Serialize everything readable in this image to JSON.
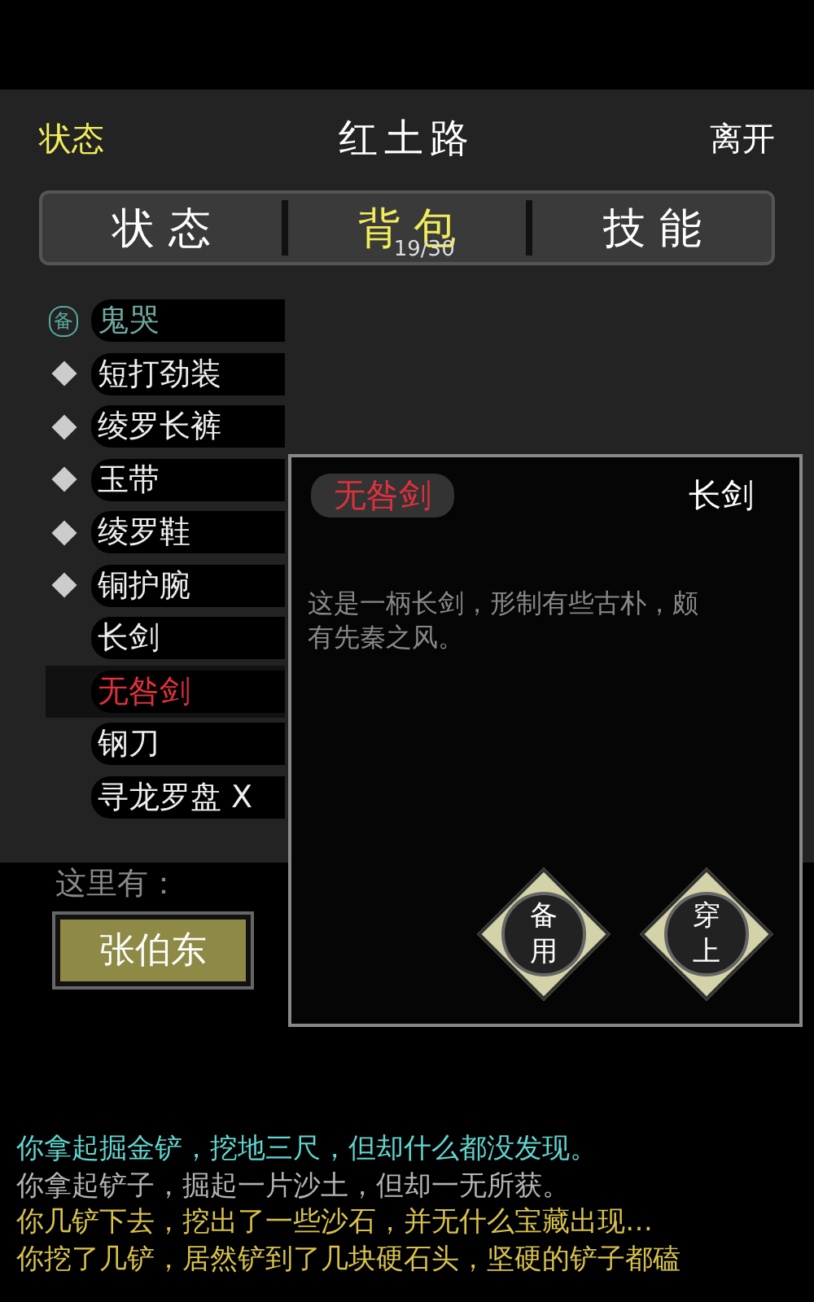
{
  "header": {
    "left": "状态",
    "title": "红土路",
    "right": "离开"
  },
  "tabs": [
    {
      "label": "状 态",
      "selected": false
    },
    {
      "label": "背 包",
      "selected": true,
      "count": "19/30"
    },
    {
      "label": "技 能",
      "selected": false
    }
  ],
  "items": [
    {
      "kind": "reserve",
      "badge": "备",
      "name": "鬼哭",
      "selected": false
    },
    {
      "kind": "equipped",
      "name": "短打劲装",
      "selected": false
    },
    {
      "kind": "equipped",
      "name": "绫罗长裤",
      "selected": false
    },
    {
      "kind": "equipped",
      "name": "玉带",
      "selected": false
    },
    {
      "kind": "equipped",
      "name": "绫罗鞋",
      "selected": false
    },
    {
      "kind": "equipped",
      "name": "铜护腕",
      "selected": false
    },
    {
      "kind": "plain",
      "name": "长剑",
      "selected": false
    },
    {
      "kind": "plain",
      "name": "无咎剑",
      "selected": true
    },
    {
      "kind": "plain",
      "name": "钢刀",
      "selected": false
    },
    {
      "kind": "plain",
      "name": "寻龙罗盘 X",
      "selected": false
    }
  ],
  "detail": {
    "name": "无咎剑",
    "type": "长剑",
    "description": "这是一柄长剑，形制有些古朴，颇有先秦之风。",
    "buttons": [
      "备用",
      "穿上"
    ]
  },
  "here": {
    "label": "这里有：",
    "npcs": [
      "张伯东"
    ]
  },
  "log": [
    {
      "text": "你拿起掘金铲，挖地三尺，但却什么都没发现。",
      "color": "#5fd6d0"
    },
    {
      "text": "你拿起铲子，掘起一片沙土，但却一无所获。",
      "color": "#b4b4b4"
    },
    {
      "text": "你几铲下去，挖出了一些沙石，并无什么宝藏出现…",
      "color": "#d8c24a"
    },
    {
      "text": "你挖了几铲，居然铲到了几块硬石头，坚硬的铲子都磕",
      "color": "#d8c24a"
    }
  ]
}
